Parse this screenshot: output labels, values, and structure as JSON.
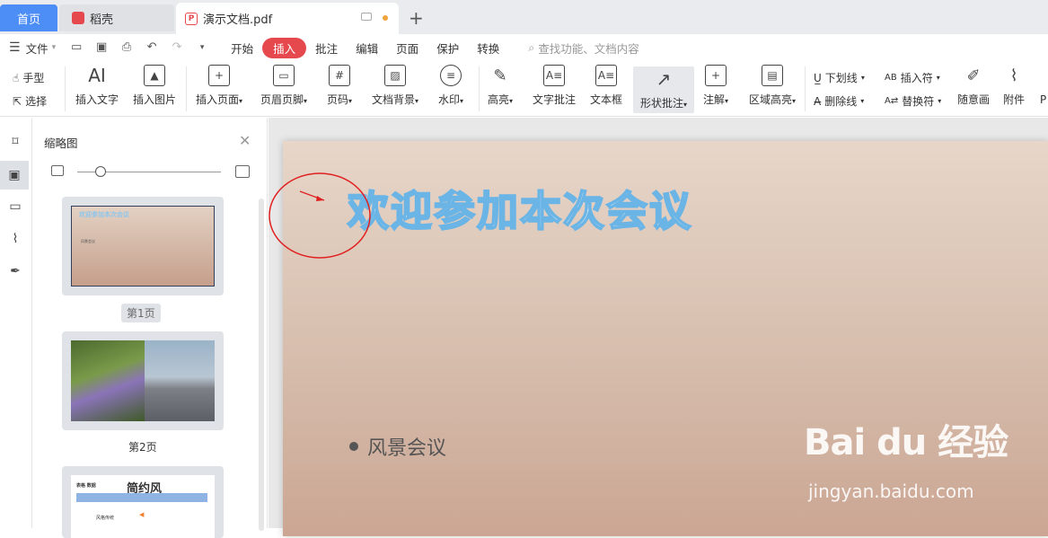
{
  "tabs": {
    "home": "首页",
    "daoke": "稻壳",
    "document": "演示文档.pdf"
  },
  "menu": {
    "file": "文件",
    "items": [
      "开始",
      "插入",
      "批注",
      "编辑",
      "页面",
      "保护",
      "转换"
    ],
    "search_placeholder": "查找功能、文档内容"
  },
  "ribbon": {
    "hand": "手型",
    "select": "选择",
    "insert_text": "插入文字",
    "insert_image": "插入图片",
    "insert_page": "插入页面",
    "header_footer": "页眉页脚",
    "page_number": "页码",
    "doc_background": "文档背景",
    "watermark": "水印",
    "highlight": "高亮",
    "text_comment": "文字批注",
    "textbox": "文本框",
    "shape_comment": "形状批注",
    "annotation": "注解",
    "area_highlight": "区域高亮",
    "underline": "下划线",
    "strikethrough": "删除线",
    "insert_char": "插入符",
    "replace_char": "替换符",
    "freehand": "随意画",
    "attachment": "附件",
    "overflow": "P"
  },
  "thumbnail_panel": {
    "title": "缩略图",
    "pages": [
      {
        "label": "第1页",
        "mini_title": "欢迎参加本次会议",
        "mini_bullet": "风景会议"
      },
      {
        "label": "第2页"
      },
      {
        "label": "",
        "mini_left": "表格 数据",
        "mini_title": "简约风",
        "mini_bottom": "风格传统"
      }
    ]
  },
  "slide": {
    "title": "欢迎参加本次会议",
    "bullet": "风景会议"
  },
  "watermark": {
    "brand": "Bai du 经验",
    "url": "jingyan.baidu.com"
  },
  "colors": {
    "accent_blue": "#4d8df6",
    "accent_red": "#e5484d",
    "title_stroke": "#6ab4e6"
  }
}
